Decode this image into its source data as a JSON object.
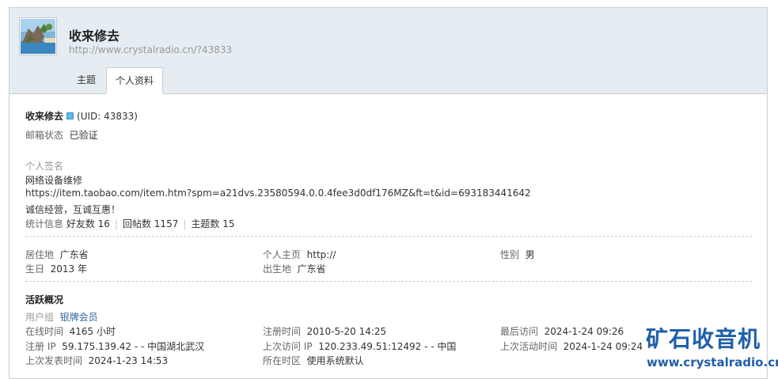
{
  "profile": {
    "username": "收来修去",
    "url": "http://www.crystalradio.cn/?43833",
    "uid_text": "(UID: 43833)"
  },
  "tabs": [
    {
      "label": "主题"
    },
    {
      "label": "个人资料"
    }
  ],
  "email": {
    "label": "邮箱状态",
    "value": "已验证"
  },
  "signature": {
    "label": "个人签名",
    "lines": [
      "网络设备维修",
      "https://item.taobao.com/item.htm?spm=a21dvs.23580594.0.0.4fee3d0df176MZ&ft=t&id=693183441642",
      "诚信经营，互诚互惠！"
    ]
  },
  "stats": {
    "label": "统计信息",
    "friends": "好友数 16",
    "posts": "回帖数 1157",
    "threads": "主题数 15"
  },
  "info": {
    "residence": {
      "label": "居住地",
      "value": "广东省"
    },
    "homepage": {
      "label": "个人主页",
      "value": "http://"
    },
    "gender": {
      "label": "性别",
      "value": "男"
    },
    "birthday": {
      "label": "生日",
      "value": "2013 年"
    },
    "birthplace": {
      "label": "出生地",
      "value": "广东省"
    }
  },
  "activity": {
    "title": "活跃概况",
    "group": {
      "label": "用户组",
      "value": "银牌会员"
    },
    "online": {
      "label": "在线时间",
      "value": "4165 小时"
    },
    "register_time": {
      "label": "注册时间",
      "value": "2010-5-20 14:25"
    },
    "last_visit": {
      "label": "最后访问",
      "value": "2024-1-24 09:26"
    },
    "register_ip": {
      "label": "注册 IP",
      "value": "59.175.139.42 - - 中国湖北武汉"
    },
    "last_ip": {
      "label": "上次访问 IP",
      "value": "120.233.49.51:12492 - - 中国"
    },
    "last_active": {
      "label": "上次活动时间",
      "value": "2024-1-24 09:24"
    },
    "last_post": {
      "label": "上次发表时间",
      "value": "2024-1-23 14:53"
    },
    "timezone": {
      "label": "所在时区",
      "value": "使用系统默认"
    }
  },
  "watermark": {
    "cn": "矿石收音机",
    "url": "www.crystalradio.cn"
  },
  "colors": {
    "header_bg": "#e5edf2",
    "link": "#336699",
    "watermark": "#1f5fa8"
  }
}
